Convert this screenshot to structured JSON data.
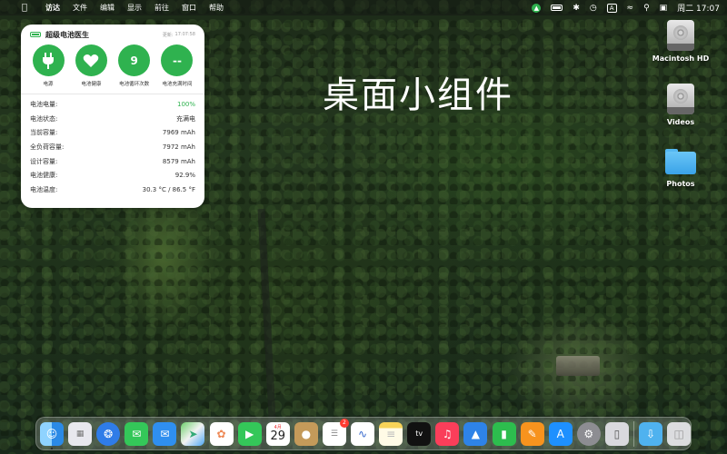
{
  "menubar": {
    "apple_icon": "apple-logo-icon",
    "app_name": "访达",
    "menus": [
      "文件",
      "编辑",
      "显示",
      "前往",
      "窗口",
      "帮助"
    ],
    "input_method": "A",
    "clock": "周二 17:07"
  },
  "widget": {
    "title": "超级电池医生",
    "updated_label": "更新:",
    "updated_time": "17:07:58",
    "circles": [
      {
        "icon": "plug-icon",
        "value": "",
        "label": "电源"
      },
      {
        "icon": "heart-icon",
        "value": "",
        "label": "电池健康"
      },
      {
        "icon": "",
        "value": "9",
        "label": "电池循环次数"
      },
      {
        "icon": "",
        "value": "--",
        "label": "电池充满时间"
      }
    ],
    "rows": [
      {
        "key": "电池电量:",
        "value": "100%"
      },
      {
        "key": "电池状态:",
        "value": "充满电"
      },
      {
        "key": "当前容量:",
        "value": "7969 mAh"
      },
      {
        "key": "全负荷容量:",
        "value": "7972 mAh"
      },
      {
        "key": "设计容量:",
        "value": "8579 mAh"
      },
      {
        "key": "电池健康:",
        "value": "92.9%"
      },
      {
        "key": "电池温度:",
        "value": "30.3 °C / 86.5 °F"
      }
    ],
    "accent_color": "#2fb24f"
  },
  "desktop": {
    "title": "桌面小组件",
    "icons": [
      {
        "label": "Macintosh HD",
        "icon": "hard-drive-icon"
      },
      {
        "label": "Videos",
        "icon": "hard-drive-icon"
      },
      {
        "label": "Photos",
        "icon": "folder-icon"
      }
    ]
  },
  "dock": {
    "apps": [
      {
        "name": "finder",
        "icon": "finder-icon"
      },
      {
        "name": "launchpad",
        "icon": "launchpad-icon"
      },
      {
        "name": "safari",
        "icon": "safari-icon"
      },
      {
        "name": "messages",
        "icon": "messages-icon"
      },
      {
        "name": "mail",
        "icon": "mail-icon"
      },
      {
        "name": "maps",
        "icon": "maps-icon"
      },
      {
        "name": "photos",
        "icon": "photos-icon"
      },
      {
        "name": "facetime",
        "icon": "facetime-icon"
      },
      {
        "name": "calendar",
        "icon": "calendar-icon",
        "month": "4月",
        "day": "29"
      },
      {
        "name": "contacts",
        "icon": "contacts-icon"
      },
      {
        "name": "reminders",
        "icon": "reminders-icon",
        "badge": "2"
      },
      {
        "name": "freeform",
        "icon": "freeform-icon"
      },
      {
        "name": "notes",
        "icon": "notes-icon"
      },
      {
        "name": "tv",
        "icon": "tv-icon",
        "text": "tv"
      },
      {
        "name": "music",
        "icon": "music-icon"
      },
      {
        "name": "keynote",
        "icon": "keynote-icon"
      },
      {
        "name": "numbers",
        "icon": "numbers-icon"
      },
      {
        "name": "pages",
        "icon": "pages-icon"
      },
      {
        "name": "app-store",
        "icon": "app-store-icon"
      },
      {
        "name": "system-settings",
        "icon": "settings-gear-icon"
      },
      {
        "name": "iphone-mirroring",
        "icon": "iphone-icon"
      },
      {
        "name": "downloads",
        "icon": "downloads-folder-icon"
      },
      {
        "name": "trash",
        "icon": "trash-icon"
      }
    ]
  }
}
